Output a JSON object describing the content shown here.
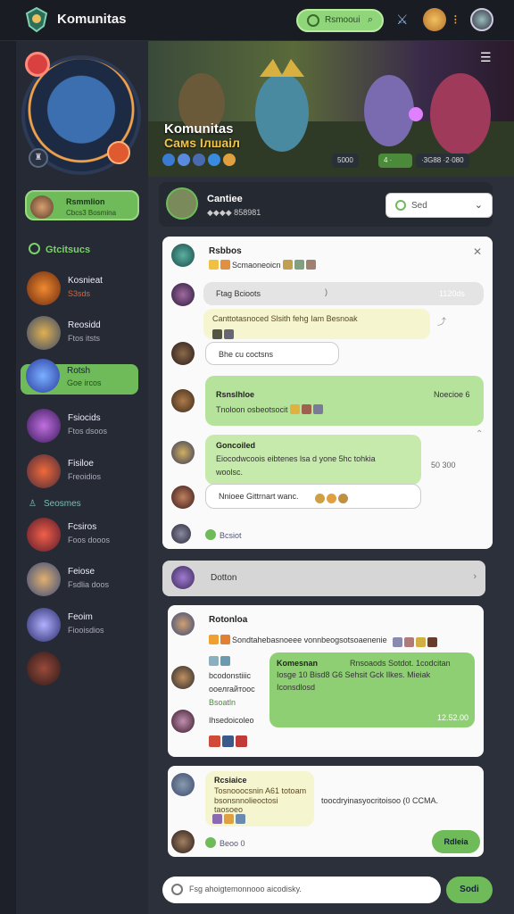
{
  "app": {
    "title": "Komunitas",
    "search_label": "Rsmooui"
  },
  "sidebar": {
    "user": {
      "name": "Rsmmlion",
      "status": "Cbcs3 Bosmina"
    },
    "section1": "Gtcitsucs",
    "section2": "Seosmes",
    "friends": [
      {
        "name": "Kosnieat",
        "status": "S3sds",
        "status_color": "#e3643a"
      },
      {
        "name": "Reosidd",
        "status": "Ftos itsts"
      },
      {
        "name": "Rotsh",
        "status": "Goe ircos"
      },
      {
        "name": "Fsiocids",
        "status": "Ftos dsoos"
      },
      {
        "name": "Fisiloe",
        "status": "Freoidios"
      },
      {
        "name": "Fcsiros",
        "status": "Foos dooos"
      },
      {
        "name": "Feiose",
        "status": "Fsdlia doos"
      },
      {
        "name": "Feoim",
        "status": "Fiooisdios"
      }
    ]
  },
  "hero": {
    "title": "Komunitas",
    "subtitle": "Caмs Ілшаіл",
    "stat1": "5000",
    "stat2": "4 ·",
    "stat3": "·3G88 ·2·080"
  },
  "channel": {
    "name": "Cantiee",
    "info": "◆◆◆◆ 858981",
    "select_value": "Sed"
  },
  "feed1": {
    "post_title": "Rsbbos",
    "post_text": "Scmaoneoicn",
    "reply_input": "Ftag Bcioots",
    "reply_count": "1120ds",
    "cream_text": "Canttotasnoced Slsith fehg Iam Besnoak",
    "cream_link": "Iam",
    "reply_btn": "Bhe cu coctsns",
    "green_title": "Rsnslhloe",
    "green_time": "Noecioe 6",
    "green_text": "Tnoloon osbeotsocit",
    "msg2_title": "Goncoiled",
    "msg2_text": "Eiocodwcoois eibtenes lsa d yone 5hc tohkia",
    "msg2_more": "woolsc.",
    "msg2_side": "50 300",
    "msg2_input": "Nnioee Gittrnart wanc.",
    "foot": "Bcsiot"
  },
  "pinned": {
    "label": "Dotton"
  },
  "feed2": {
    "title": "Rotonloa",
    "text": "Sondtahebasnoeee vonnbeogsotsoaenenie",
    "aside1": "bcodonstiiic",
    "aside2": "ооелгайтоос",
    "aside3": "Bsoatln",
    "aside4": "Ihsedoicoleo",
    "green_title": "Komesnan",
    "green_head": "Rnsoaods Sotdot. 1codcitan",
    "green_body1": "Iosge 10 Bisd8 G6 Sehsit Gck Ilkes. Mieiak",
    "green_body2": "Iconsdlosd",
    "green_time": "12.52.00"
  },
  "feed3": {
    "title": "Rcsiaice",
    "text1": "Tosnooocsnin A61 totoam",
    "text2": "bsonsnnolieoctosi taosoeo",
    "side": "toocdryinasyocritoisoo (0 CCMA.",
    "btn": "Rdleia",
    "foot": "Beoo 0"
  },
  "input": {
    "placeholder": "Fsg ahoigtemonnooo aicodisky.",
    "send": "Sodi"
  }
}
